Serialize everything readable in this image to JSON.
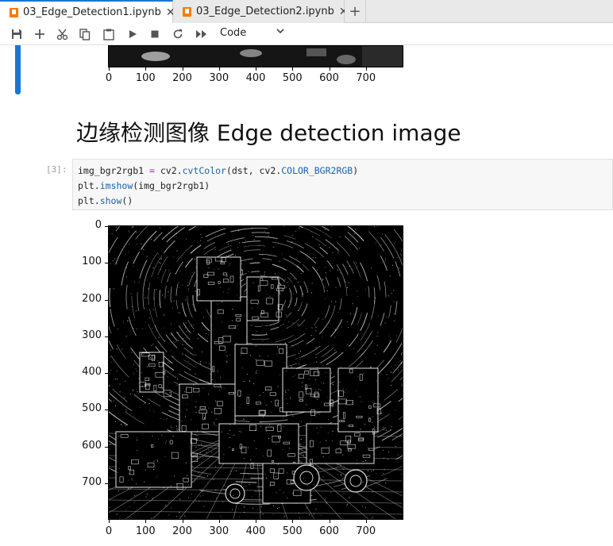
{
  "tabs": [
    {
      "label": "03_Edge_Detection1.ipynb",
      "active": true
    },
    {
      "label": "03_Edge_Detection2.ipynb",
      "active": false
    }
  ],
  "newtab_symbol": "+",
  "toolbar": {
    "icons": [
      "save-icon",
      "add-icon",
      "cut-icon",
      "copy-icon",
      "paste-icon",
      "run-icon",
      "stop-icon",
      "restart-icon",
      "fast-forward-icon"
    ],
    "cell_type": "Code"
  },
  "heading": "边缘检测图像 Edge detection image",
  "cell": {
    "prompt": "[3]:",
    "lines": [
      [
        [
          "img_bgr2rgb1 ",
          "name"
        ],
        [
          "=",
          "op"
        ],
        [
          " cv2.",
          "name"
        ],
        [
          "cvtColor",
          "fn"
        ],
        [
          "(dst, cv2.",
          "name"
        ],
        [
          "COLOR_BGR2RGB",
          "fn"
        ],
        [
          ")",
          "pun"
        ]
      ],
      [
        [
          "plt.",
          "name"
        ],
        [
          "imshow",
          "fn"
        ],
        [
          "(img_bgr2rgb1)",
          "pun"
        ]
      ],
      [
        [
          "plt.",
          "name"
        ],
        [
          "show",
          "fn"
        ],
        [
          "()",
          "pun"
        ]
      ]
    ]
  },
  "axes": {
    "x_ticks": [
      "0",
      "100",
      "200",
      "300",
      "400",
      "500",
      "600",
      "700"
    ],
    "y_ticks": [
      "0",
      "100",
      "200",
      "300",
      "400",
      "500",
      "600",
      "700"
    ],
    "xlim": [
      0,
      800
    ],
    "ylim": [
      0,
      800
    ]
  },
  "colors": {
    "accent": "#1976d2",
    "tab_icon": "#f57c00",
    "code_fn": "#1e62a8",
    "code_op": "#9c27b0"
  }
}
